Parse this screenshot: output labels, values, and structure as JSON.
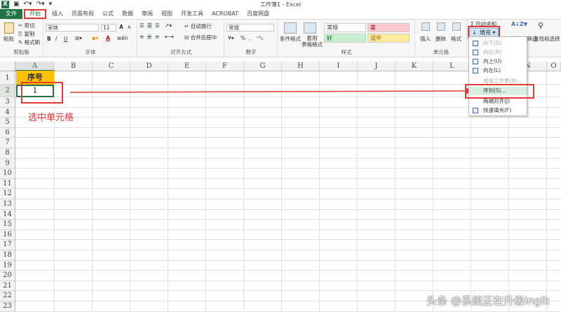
{
  "window": {
    "title": "工作簿1 - Excel"
  },
  "tabs": [
    {
      "label": "文件"
    },
    {
      "label": "开始"
    },
    {
      "label": "插入"
    },
    {
      "label": "页面布局"
    },
    {
      "label": "公式"
    },
    {
      "label": "数据"
    },
    {
      "label": "审阅"
    },
    {
      "label": "视图"
    },
    {
      "label": "开发工具"
    },
    {
      "label": "ACROBAT"
    },
    {
      "label": "百度网盘"
    }
  ],
  "ribbon": {
    "clipboard": {
      "label": "剪贴板",
      "paste": "粘贴",
      "cut": "剪切",
      "copy": "复制",
      "format_painter": "格式刷"
    },
    "font": {
      "label": "字体",
      "name": "宋体",
      "size": "11",
      "bold": "B",
      "italic": "I",
      "underline": "U",
      "font_color_glyph": "A",
      "grow": "A",
      "shrink": "A",
      "phonetic": "wén"
    },
    "alignment": {
      "label": "对齐方式",
      "wrap": "自动换行",
      "merge": "合并后居中"
    },
    "number": {
      "label": "数字",
      "format": "常规",
      "percent": "%",
      "comma": ","
    },
    "styles": {
      "label": "样式",
      "conditional": "条件格式",
      "table": "套用\n表格格式",
      "normal": "常规",
      "bad": "差",
      "good": "好",
      "neutral": "适中"
    },
    "cells": {
      "label": "单元格",
      "insert": "插入",
      "delete": "删除",
      "format": "格式"
    },
    "editing": {
      "autosum": "自动求和",
      "fill": "填充",
      "sort": "排序和筛选",
      "find": "查找和选择"
    }
  },
  "fill_menu": {
    "items": [
      {
        "label": "向下(D)",
        "disabled": true
      },
      {
        "label": "向右(R)",
        "disabled": true
      },
      {
        "label": "向上(U)",
        "disabled": false
      },
      {
        "label": "向左(L)",
        "disabled": false
      },
      {
        "label": "成组工作表(A)...",
        "disabled": true
      },
      {
        "label": "序列(S)...",
        "disabled": false
      },
      {
        "label": "两端对齐(J)",
        "disabled": false
      },
      {
        "label": "快速填充(F)",
        "disabled": false
      }
    ]
  },
  "sheet": {
    "columns": [
      "A",
      "B",
      "C",
      "D",
      "E",
      "F",
      "G",
      "H",
      "I",
      "J",
      "K",
      "L",
      "M",
      "N",
      "O"
    ],
    "rows": [
      "1",
      "2",
      "3",
      "4",
      "5",
      "6",
      "7",
      "8",
      "9",
      "10",
      "11",
      "12",
      "13",
      "14",
      "15",
      "16",
      "17",
      "18",
      "19",
      "20",
      "21",
      "22",
      "23"
    ],
    "a1": "序号",
    "a2": "1"
  },
  "annotation": "选中单元格",
  "watermark": "头条 @系统正在升级inglk",
  "colors": {
    "excel_green": "#217346",
    "highlight_red": "#e53935",
    "header_fill": "#ffc000"
  }
}
